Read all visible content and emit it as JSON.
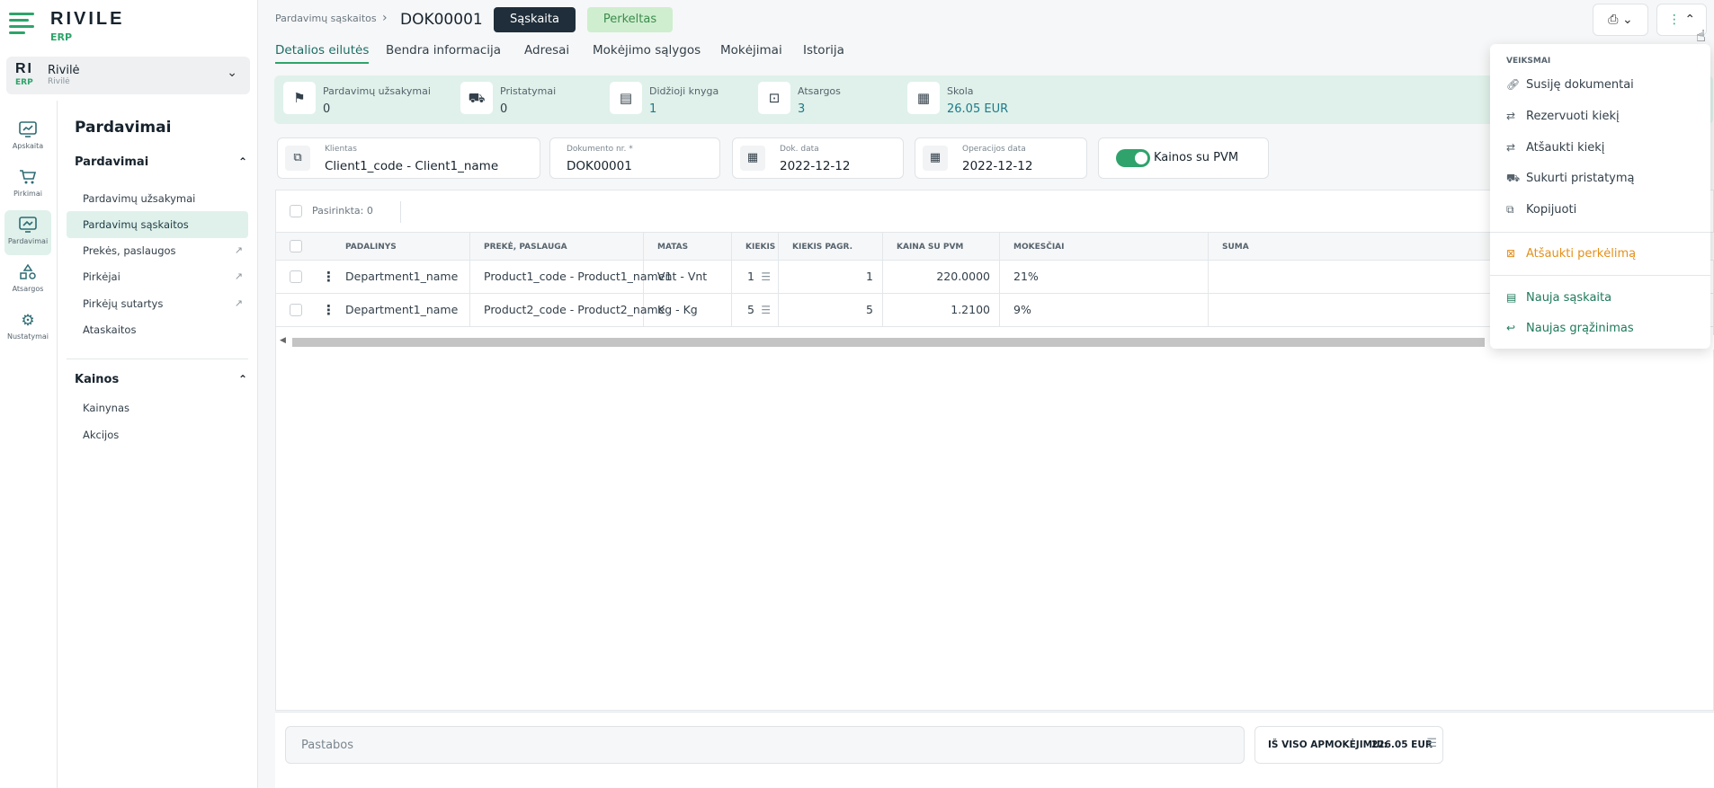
{
  "app": {
    "brand": "RIVILE",
    "brand_sub": "ERP",
    "company_short": "RI",
    "company_short_sub": "ERP",
    "company_name": "Rivilė",
    "company_sub": "Rivilė",
    "accent_color": "#2fa36b"
  },
  "rail": {
    "items": [
      {
        "label": "Apskaita",
        "icon": "chart-icon"
      },
      {
        "label": "Pirkimai",
        "icon": "cart-icon"
      },
      {
        "label": "Pardavimai",
        "icon": "sales-icon"
      },
      {
        "label": "Atsargos",
        "icon": "shapes-icon"
      },
      {
        "label": "Nustatymai",
        "icon": "gear-icon"
      }
    ]
  },
  "menu": {
    "title": "Pardavimai",
    "section1": "Pardavimai",
    "section1_items": [
      "Pardavimų užsakymai",
      "Pardavimų sąskaitos",
      "Prekės, paslaugos",
      "Pirkėjai",
      "Pirkėjų sutartys",
      "Ataskaitos"
    ],
    "section2": "Kainos",
    "section2_items": [
      "Kainynas",
      "Akcijos"
    ]
  },
  "header": {
    "breadcrumb": "Pardavimų sąskaitos",
    "doc_number": "DOK00001",
    "type_button": "Sąskaita",
    "status_badge": "Perkeltas"
  },
  "tabs": [
    "Detalios eilutės",
    "Bendra informacija",
    "Adresai",
    "Mokėjimo sąlygos",
    "Mokėjimai",
    "Istorija"
  ],
  "stats": [
    {
      "label": "Pardavimų užsakymai",
      "value": "0"
    },
    {
      "label": "Pristatymai",
      "value": "0"
    },
    {
      "label": "Didžioji knyga",
      "value": "1"
    },
    {
      "label": "Atsargos",
      "value": "3"
    },
    {
      "label": "Skola",
      "value": "26.05 EUR"
    }
  ],
  "fields": {
    "client_label": "Klientas",
    "client_value": "Client1_code - Client1_name",
    "docno_label": "Dokumento nr. *",
    "docno_value": "DOK00001",
    "docdate_label": "Dok. data",
    "docdate_value": "2022-12-12",
    "opdate_label": "Operacijos data",
    "opdate_value": "2022-12-12",
    "vat_toggle_label": "Kainos su PVM"
  },
  "table": {
    "selected_text": "Pasirinkta: 0",
    "columns": [
      "PADALINYS",
      "PREKĖ, PASLAUGA",
      "MATAS",
      "KIEKIS",
      "KIEKIS PAGR.",
      "KAINA SU PVM",
      "MOKESČIAI",
      "SUMA"
    ],
    "rows": [
      [
        "Department1_name",
        "Product1_code - Product1_name1",
        "Vnt - Vnt",
        "1",
        "1",
        "220.0000",
        "21%"
      ],
      [
        "Department1_name",
        "Product2_code - Product2_name",
        "Kg - Kg",
        "5",
        "5",
        "1.2100",
        "9%"
      ]
    ]
  },
  "footer": {
    "notes_placeholder": "Pastabos",
    "total_label": "IŠ VISO APMOKĖJIMUI:",
    "total_value": "226.05 EUR"
  },
  "dropdown": {
    "title": "VEIKSMAI",
    "items": [
      "Susiję dokumentai",
      "Rezervuoti kiekį",
      "Atšaukti kiekį",
      "Sukurti pristatymą",
      "Kopijuoti"
    ],
    "cancel_transfer": "Atšaukti perkėlimą",
    "new_invoice": "Nauja sąskaita",
    "new_return": "Naujas grąžinimas"
  }
}
